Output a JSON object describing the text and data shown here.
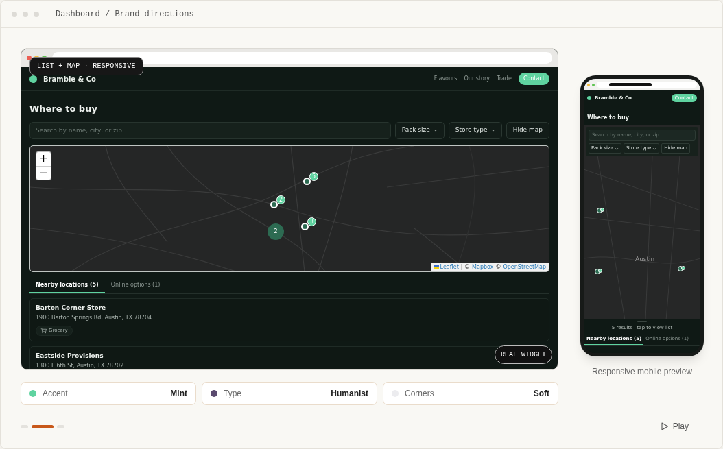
{
  "window": {
    "breadcrumb": "Dashboard / Brand directions"
  },
  "preview": {
    "badge": "LIST + MAP · RESPONSIVE",
    "overlay_badge": "REAL WIDGET",
    "site": {
      "brand": "Bramble & Co",
      "nav": [
        {
          "label": "Flavours",
          "kind": "link"
        },
        {
          "label": "Our story",
          "kind": "link"
        },
        {
          "label": "Trade",
          "kind": "link"
        },
        {
          "label": "Contact",
          "kind": "cta"
        }
      ],
      "heading": "Where to buy",
      "search": {
        "placeholder": "Search by name, city, or zip"
      },
      "filters": [
        {
          "label": "Pack size",
          "kind": "dropdown"
        },
        {
          "label": "Store type",
          "kind": "dropdown"
        },
        {
          "label": "Hide map",
          "kind": "button"
        }
      ],
      "map": {
        "zoom_controls": [
          "+",
          "−"
        ],
        "markers": [
          {
            "kind": "pin",
            "count": "5"
          },
          {
            "kind": "pin",
            "count": "2"
          },
          {
            "kind": "pin",
            "count": "3"
          },
          {
            "kind": "cluster",
            "count": "2"
          }
        ],
        "attribution": {
          "leaflet": "Leaflet",
          "rest": "| ©",
          "mapbox": "Mapbox",
          "sep": "©",
          "osm": "OpenStreetMap"
        }
      },
      "tabs": [
        {
          "label": "Nearby locations (5)",
          "selected": true
        },
        {
          "label": "Online options (1)",
          "selected": false
        }
      ],
      "locations": [
        {
          "name": "Barton Corner Store",
          "address": "1900 Barton Springs Rd, Austin, TX 78704",
          "tag": "Grocery"
        },
        {
          "name": "Eastside Provisions",
          "address": "1300 E 6th St, Austin, TX 78702"
        }
      ]
    }
  },
  "mobile": {
    "brand": "Bramble & Co",
    "cta": "Contact",
    "heading": "Where to buy",
    "search": {
      "placeholder": "Search by name, city, or zip"
    },
    "filters": [
      {
        "label": "Pack size",
        "kind": "dropdown"
      },
      {
        "label": "Store type",
        "kind": "dropdown"
      },
      {
        "label": "Hide map",
        "kind": "button"
      }
    ],
    "map_label": "Austin",
    "sheet_text": "5 results · tap to view list",
    "tabs": [
      {
        "label": "Nearby locations (5)",
        "selected": true
      },
      {
        "label": "Online options (1)",
        "selected": false
      }
    ],
    "caption": "Responsive mobile preview"
  },
  "swatches": [
    {
      "label": "Accent",
      "value": "Mint",
      "color": "#5fd3a0"
    },
    {
      "label": "Type",
      "value": "Humanist",
      "color": "#5a4a6e"
    },
    {
      "label": "Corners",
      "value": "Soft",
      "color": "#ececef"
    }
  ],
  "pager": [
    {
      "selected": false
    },
    {
      "selected": true
    },
    {
      "selected": false
    }
  ],
  "play": "Play"
}
